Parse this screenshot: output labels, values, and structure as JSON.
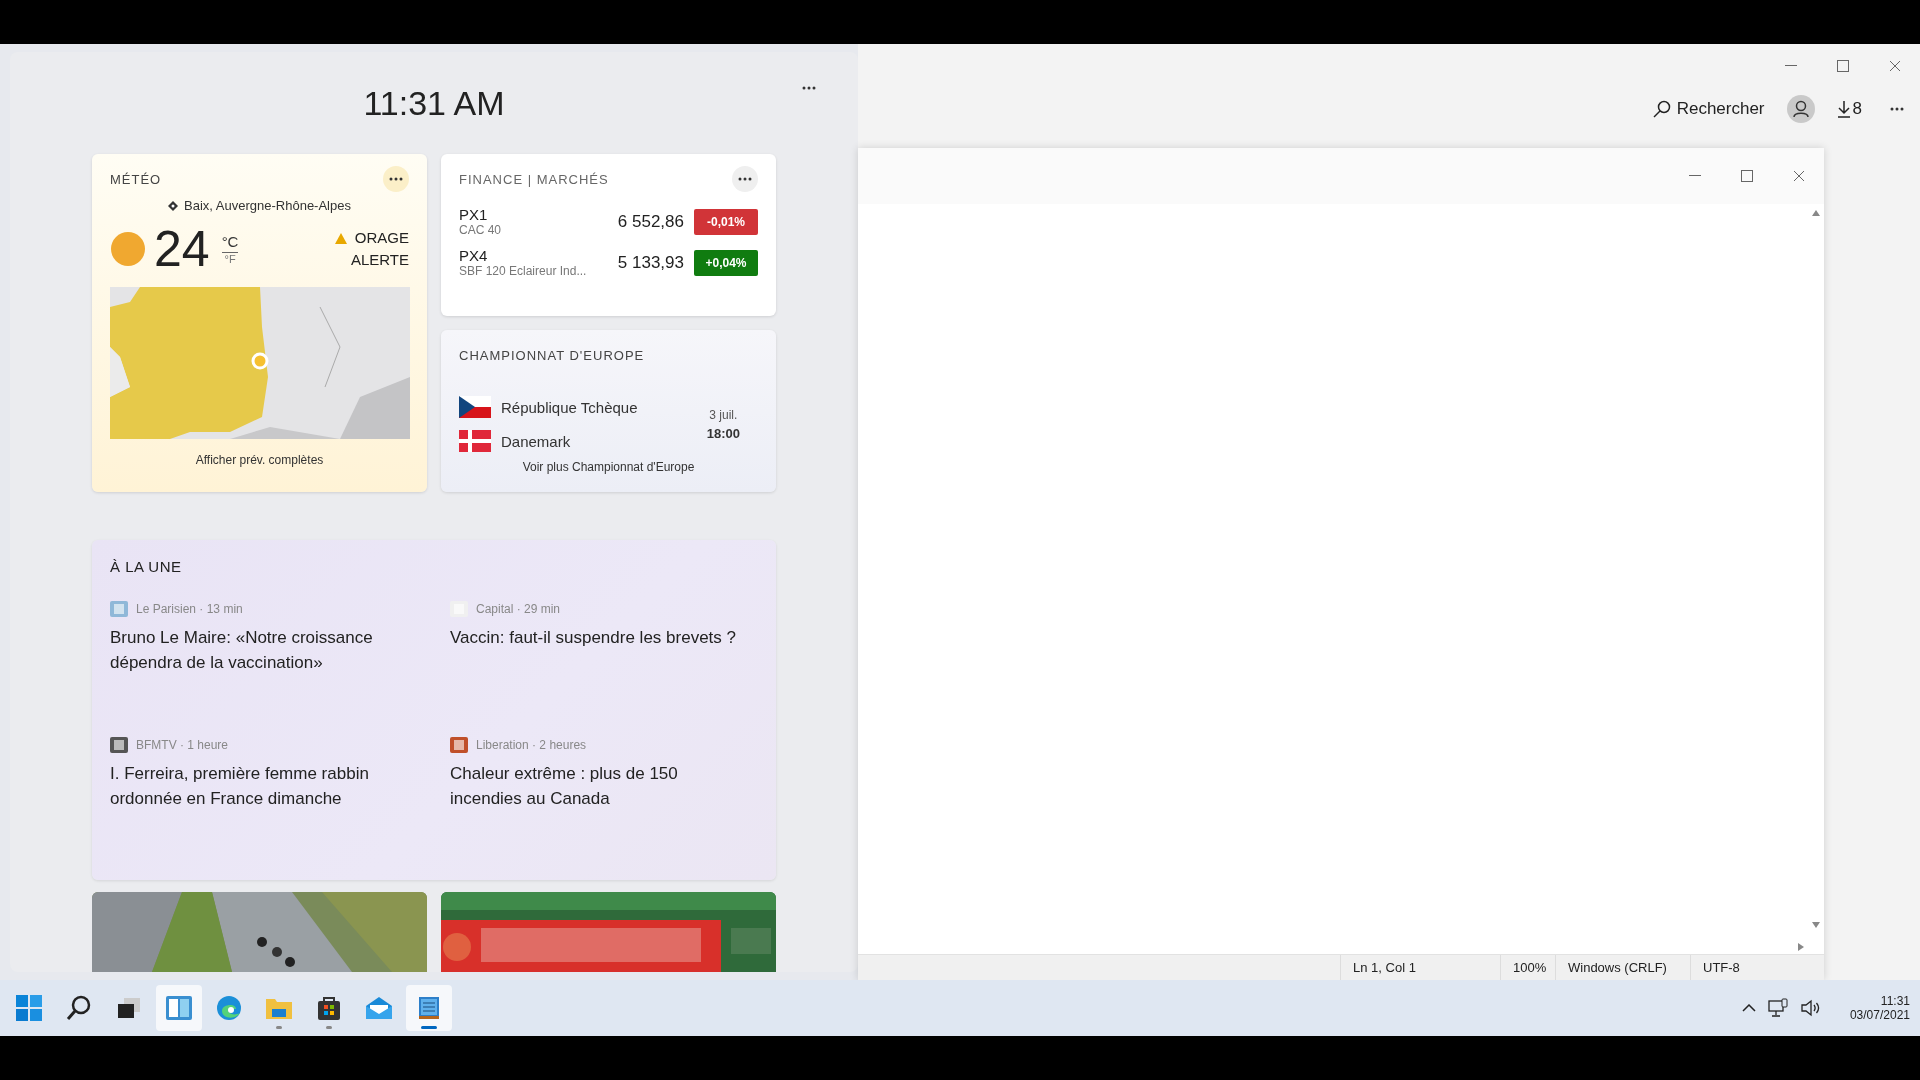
{
  "widgets": {
    "time": "11:31 AM",
    "weather": {
      "title": "MÉTÉO",
      "location": "Baix, Auvergne-Rhône-Alpes",
      "temperature": "24",
      "unit_c": "°C",
      "unit_f": "°F",
      "alert_lines": [
        "ORAGE",
        "ALERTE"
      ],
      "link": "Afficher prév. complètes"
    },
    "finance": {
      "title": "FINANCE | MARCHÉS",
      "quotes": [
        {
          "symbol": "PX1",
          "name": "CAC 40",
          "value": "6 552,86",
          "change": "-0,01%",
          "kind": "down"
        },
        {
          "symbol": "PX4",
          "name": "SBF 120 Eclaireur Ind...",
          "value": "5 133,93",
          "change": "+0,04%",
          "kind": "up"
        }
      ]
    },
    "match": {
      "title": "CHAMPIONNAT D'EUROPE",
      "teams": [
        {
          "name": "République Tchèque",
          "kind": "czech"
        },
        {
          "name": "Danemark",
          "kind": "denmark"
        }
      ],
      "date": "3 juil.",
      "time": "18:00",
      "link": "Voir plus Championnat d'Europe"
    },
    "news": {
      "title": "À LA UNE",
      "items": [
        {
          "source": "Le Parisien · 13 min",
          "headline": "Bruno Le Maire: «Notre croissance dépendra de la vaccination»"
        },
        {
          "source": "Capital · 29 min",
          "headline": "Vaccin: faut-il suspendre les brevets ?"
        },
        {
          "source": "BFMTV · 1 heure",
          "headline": "I. Ferreira, première femme rabbin ordonnée en France dimanche"
        },
        {
          "source": "Liberation · 2 heures",
          "headline": "Chaleur extrême : plus de 150 incendies au Canada"
        }
      ]
    }
  },
  "browser": {
    "search_label": "Rechercher",
    "downloads": "8"
  },
  "notepad": {
    "status_bar": [
      "Ln 1, Col 1",
      "100%",
      "Windows (CRLF)",
      "UTF-8"
    ]
  },
  "taskbar": {
    "apps": [
      {
        "kind": "start",
        "running": false,
        "selected": false
      },
      {
        "kind": "search",
        "running": false,
        "selected": false
      },
      {
        "kind": "taskview",
        "running": false,
        "selected": false
      },
      {
        "kind": "widgets",
        "running": false,
        "selected": true
      },
      {
        "kind": "edge",
        "running": false,
        "selected": false
      },
      {
        "kind": "explorer",
        "running": true,
        "selected": false
      },
      {
        "kind": "store",
        "running": true,
        "selected": false
      },
      {
        "kind": "mail",
        "running": false,
        "selected": false
      },
      {
        "kind": "notepad",
        "running": true,
        "selected": true
      }
    ],
    "clock": {
      "time": "11:31",
      "date": "03/07/2021"
    }
  }
}
